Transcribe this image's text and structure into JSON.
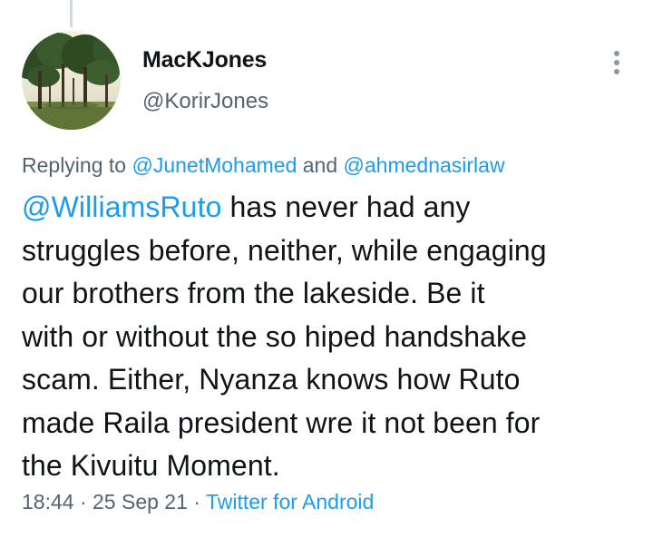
{
  "author": {
    "display_name": "MacKJones",
    "handle": "@KorirJones",
    "avatar": "avatar-trees-photo"
  },
  "more_menu": {
    "icon": "more-vertical-icon"
  },
  "reply_context": {
    "prefix": "Replying to",
    "mention_1": "@JunetMohamed",
    "joiner": "and",
    "mention_2": "@ahmednasirlaw"
  },
  "tweet": {
    "mention": "@WilliamsRuto",
    "line_1_rest": " has never had any",
    "lines": [
      "struggles before, neither, while engaging",
      "our brothers from the lakeside. Be it",
      "with or without the so hiped handshake",
      "scam. Either, Nyanza knows how Ruto",
      "made Raila president wre it not been for",
      "the Kivuitu Moment."
    ]
  },
  "meta": {
    "time": "18:44",
    "separator": "·",
    "date": "25 Sep 21",
    "source": "Twitter for Android"
  },
  "colors": {
    "link": "#1d9bf0",
    "secondary_text": "#536471",
    "primary_text": "#0f1419"
  }
}
